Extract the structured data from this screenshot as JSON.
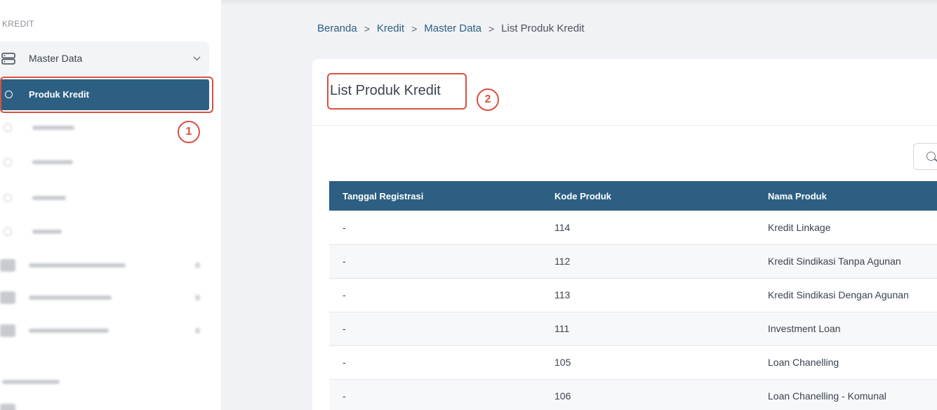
{
  "sidebar": {
    "section_label": "KREDIT",
    "parent_item": {
      "label": "Master Data",
      "icon": "server-icon",
      "expanded": true
    },
    "active_item": {
      "label": "Produk Kredit"
    },
    "annotations": {
      "callout_1": "1"
    }
  },
  "breadcrumb": {
    "items": [
      "Beranda",
      "Kredit",
      "Master Data"
    ],
    "current": "List Produk Kredit",
    "separator": ">"
  },
  "main": {
    "title": "List Produk Kredit",
    "annotations": {
      "callout_2": "2"
    },
    "table": {
      "headers": [
        "Tanggal Registrasi",
        "Kode Produk",
        "Nama Produk"
      ],
      "rows": [
        [
          "-",
          "114",
          "Kredit Linkage"
        ],
        [
          "-",
          "112",
          "Kredit Sindikasi Tanpa Agunan"
        ],
        [
          "-",
          "113",
          "Kredit Sindikasi Dengan Agunan"
        ],
        [
          "-",
          "111",
          "Investment Loan"
        ],
        [
          "-",
          "105",
          "Loan Chanelling"
        ],
        [
          "-",
          "106",
          "Loan Chanelling - Komunal"
        ]
      ]
    }
  },
  "colors": {
    "primary": "#2c5f82",
    "callout": "#d9503f",
    "background": "#f1f2f5"
  }
}
